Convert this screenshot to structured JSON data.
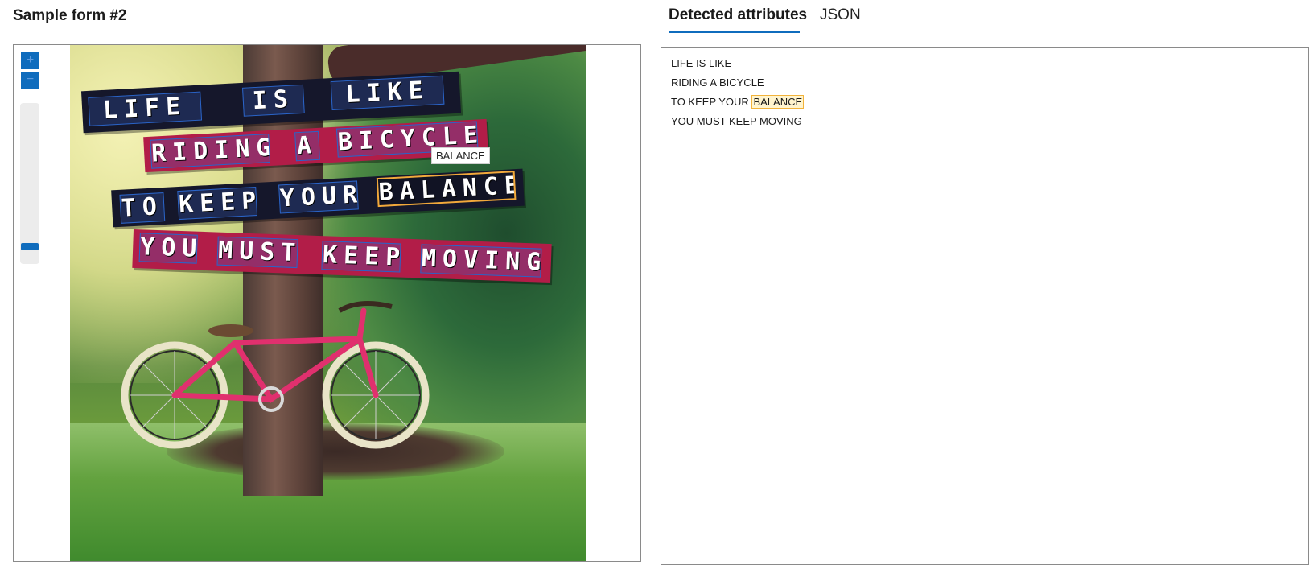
{
  "form_title": "Sample form #2",
  "viewer": {
    "zoom_in_label": "+",
    "zoom_out_label": "−",
    "zoom_level": 0.06,
    "image": {
      "banners": [
        {
          "words": [
            "LIFE",
            "IS",
            "LIKE"
          ]
        },
        {
          "words": [
            "RIDING",
            "A",
            "BICYCLE"
          ]
        },
        {
          "words": [
            "TO",
            "KEEP",
            "YOUR",
            "BALANCE"
          ]
        },
        {
          "words": [
            "YOU",
            "MUST",
            "KEEP",
            "MOVING"
          ]
        }
      ],
      "hover_tooltip": "BALANCE"
    }
  },
  "tabs": [
    {
      "label": "Detected attributes",
      "active": true
    },
    {
      "label": "JSON",
      "active": false
    }
  ],
  "detected": {
    "lines": [
      "LIFE IS LIKE",
      "RIDING A BICYCLE",
      "TO KEEP YOUR",
      "YOU MUST KEEP MOVING"
    ],
    "highlighted_word": "BALANCE"
  },
  "colors": {
    "accent": "#0f6cbd",
    "highlight": "#f2a93b",
    "highlight_bg": "#fff4ce"
  }
}
